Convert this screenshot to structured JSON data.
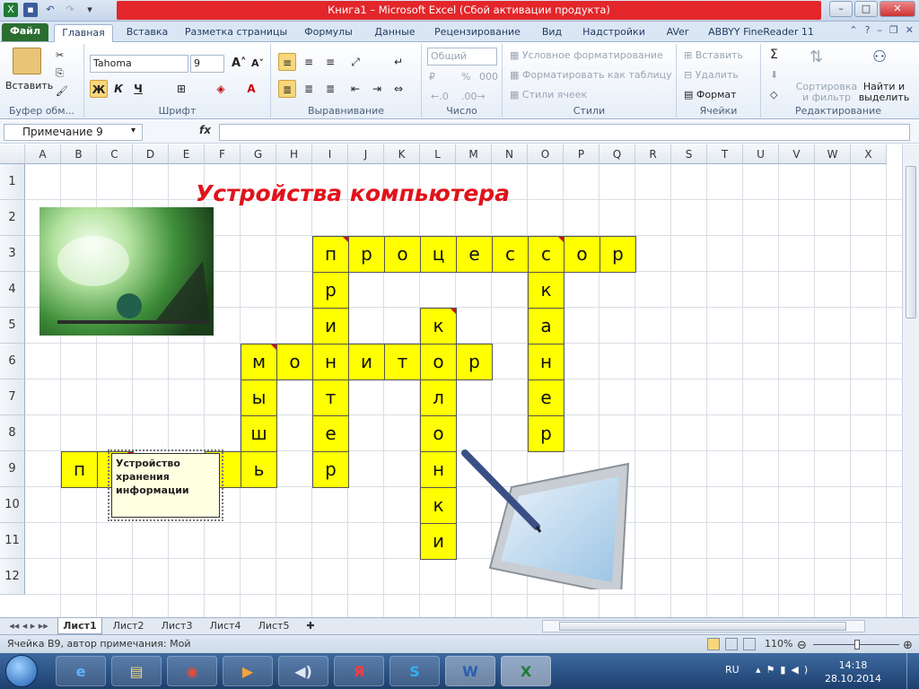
{
  "window": {
    "title": "Книга1  –  Microsoft Excel (Сбой активации продукта)",
    "controls": [
      "–",
      "□",
      "✕"
    ]
  },
  "tabs": {
    "file": "Файл",
    "items": [
      "Главная",
      "Вставка",
      "Разметка страницы",
      "Формулы",
      "Данные",
      "Рецензирование",
      "Вид",
      "Надстройки",
      "AVer",
      "ABBYY FineReader 11"
    ]
  },
  "ribbon": {
    "clipboard": {
      "paste": "Вставить",
      "label": "Буфер обм..."
    },
    "font": {
      "name": "Tahoma",
      "size": "9",
      "bold": "Ж",
      "italic": "К",
      "underline": "Ч",
      "label": "Шрифт"
    },
    "alignment": {
      "label": "Выравнивание"
    },
    "number": {
      "format": "Общий",
      "percent": "%",
      "thousands": "000",
      "label": "Число"
    },
    "styles": {
      "conditional": "Условное форматирование",
      "table": "Форматировать как таблицу",
      "cell_styles": "Стили ячеек",
      "label": "Стили"
    },
    "cells": {
      "insert": "Вставить",
      "delete": "Удалить",
      "format": "Формат",
      "label": "Ячейки"
    },
    "editing": {
      "sigma": "Σ",
      "sort": "Сортировка и фильтр",
      "find": "Найти и выделить",
      "label": "Редактирование"
    }
  },
  "formula_bar": {
    "name_box": "Примечание 9",
    "fx": "fx",
    "value": ""
  },
  "columns": [
    "A",
    "B",
    "C",
    "D",
    "E",
    "F",
    "G",
    "H",
    "I",
    "J",
    "K",
    "L",
    "M",
    "N",
    "O",
    "P",
    "Q",
    "R",
    "S",
    "T",
    "U",
    "V",
    "W",
    "X"
  ],
  "rows": [
    "1",
    "2",
    "3",
    "4",
    "5",
    "6",
    "7",
    "8",
    "9",
    "10",
    "11",
    "12"
  ],
  "sheet": {
    "title": "Устройства компьютера",
    "comment": "Устройство хранения информации",
    "crossword": [
      {
        "col": "I",
        "row": 3,
        "ch": "п",
        "note": true
      },
      {
        "col": "J",
        "row": 3,
        "ch": "р"
      },
      {
        "col": "K",
        "row": 3,
        "ch": "о"
      },
      {
        "col": "L",
        "row": 3,
        "ch": "ц"
      },
      {
        "col": "M",
        "row": 3,
        "ch": "е"
      },
      {
        "col": "N",
        "row": 3,
        "ch": "с"
      },
      {
        "col": "O",
        "row": 3,
        "ch": "с",
        "note": true
      },
      {
        "col": "P",
        "row": 3,
        "ch": "о"
      },
      {
        "col": "Q",
        "row": 3,
        "ch": "р"
      },
      {
        "col": "I",
        "row": 4,
        "ch": "р"
      },
      {
        "col": "O",
        "row": 4,
        "ch": "к"
      },
      {
        "col": "I",
        "row": 5,
        "ch": "и"
      },
      {
        "col": "L",
        "row": 5,
        "ch": "к",
        "note": true
      },
      {
        "col": "O",
        "row": 5,
        "ch": "а"
      },
      {
        "col": "G",
        "row": 6,
        "ch": "м",
        "note": true
      },
      {
        "col": "H",
        "row": 6,
        "ch": "о"
      },
      {
        "col": "I",
        "row": 6,
        "ch": "н"
      },
      {
        "col": "J",
        "row": 6,
        "ch": "и"
      },
      {
        "col": "K",
        "row": 6,
        "ch": "т"
      },
      {
        "col": "L",
        "row": 6,
        "ch": "о"
      },
      {
        "col": "M",
        "row": 6,
        "ch": "р"
      },
      {
        "col": "O",
        "row": 6,
        "ch": "н"
      },
      {
        "col": "G",
        "row": 7,
        "ch": "ы"
      },
      {
        "col": "I",
        "row": 7,
        "ch": "т"
      },
      {
        "col": "L",
        "row": 7,
        "ch": "л"
      },
      {
        "col": "O",
        "row": 7,
        "ch": "е"
      },
      {
        "col": "G",
        "row": 8,
        "ch": "ш"
      },
      {
        "col": "I",
        "row": 8,
        "ch": "е"
      },
      {
        "col": "L",
        "row": 8,
        "ch": "о"
      },
      {
        "col": "O",
        "row": 8,
        "ch": "р"
      },
      {
        "col": "B",
        "row": 9,
        "ch": "п"
      },
      {
        "col": "C",
        "row": 9,
        "ch": "",
        "note": true
      },
      {
        "col": "F",
        "row": 9,
        "ch": ""
      },
      {
        "col": "G",
        "row": 9,
        "ch": "ь"
      },
      {
        "col": "I",
        "row": 9,
        "ch": "р"
      },
      {
        "col": "L",
        "row": 9,
        "ch": "н"
      },
      {
        "col": "L",
        "row": 10,
        "ch": "к"
      },
      {
        "col": "L",
        "row": 11,
        "ch": "и"
      }
    ]
  },
  "sheet_tabs": [
    "Лист1",
    "Лист2",
    "Лист3",
    "Лист4",
    "Лист5"
  ],
  "status": {
    "text": "Ячейка B9, автор примечания: Мой",
    "zoom": "110%"
  },
  "taskbar": {
    "lang": "RU",
    "time": "14:18",
    "date": "28.10.2014",
    "apps": [
      "e",
      "▤",
      "◉",
      "▶",
      "◀)",
      "Я",
      "S",
      "W",
      "X"
    ]
  }
}
